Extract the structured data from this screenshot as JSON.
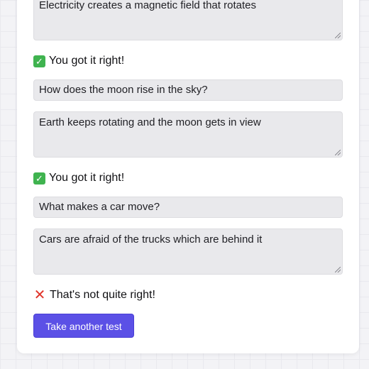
{
  "qa": [
    {
      "answer": "Electricity creates a magnetic field that rotates",
      "feedback": "You got it right!",
      "correct": true
    },
    {
      "question": "How does the moon rise in the sky?",
      "answer": "Earth keeps rotating and the moon gets in view",
      "feedback": "You got it right!",
      "correct": true
    },
    {
      "question": "What makes a car move?",
      "answer": "Cars are afraid of the trucks which are behind it",
      "feedback": "That's not quite right!",
      "correct": false
    }
  ],
  "icons": {
    "correct": "check-mark-icon",
    "incorrect": "cross-mark-icon"
  },
  "colors": {
    "accent": "#5b50e6",
    "correct": "#3fb34f",
    "incorrect": "#e0342a"
  },
  "actions": {
    "retake_label": "Take another test"
  }
}
